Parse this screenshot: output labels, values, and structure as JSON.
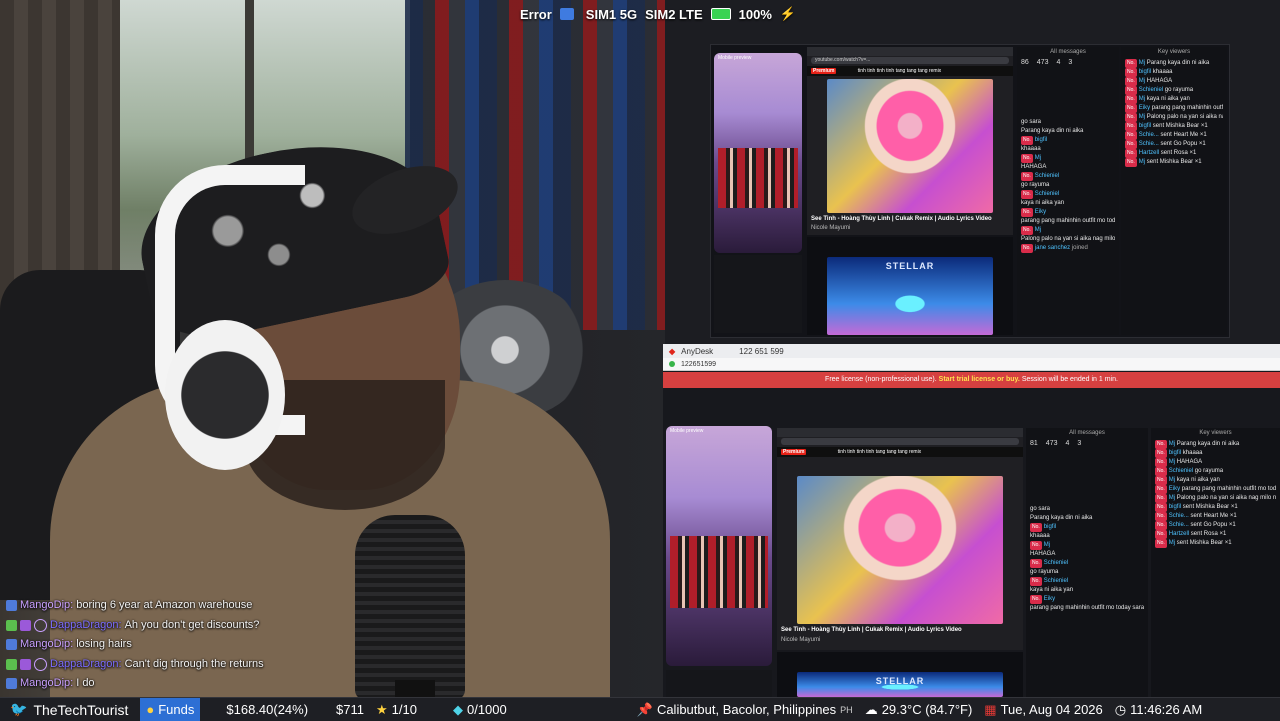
{
  "status_bar": {
    "error": "Error",
    "sim1": "SIM1 5G",
    "sim2": "SIM2 LTE",
    "battery": "100%"
  },
  "capture_top": {
    "phone_title": "Mobile preview",
    "url": "youtube.com/watch?v=...",
    "search_text": "tinh tinh tinh tinh tang tang tang remix",
    "video_title": "See Tinh - Hoàng Thùy Linh | Cukak Remix | Audio Lyrics Video",
    "channel": "Nicole Mayumi",
    "video2_text": "STELLAR",
    "stats": {
      "likes": "86",
      "viewers": "473",
      "hearts": "4",
      "people": "3"
    },
    "chat_header": "All messages",
    "side_header": "Key viewers",
    "chat": [
      {
        "user": "",
        "text": "go sara"
      },
      {
        "user": "",
        "text": "Parang kaya din ni aika"
      },
      {
        "user": "bigfil",
        "text": ""
      },
      {
        "user": "",
        "text": "khaaaa"
      },
      {
        "user": "Mj",
        "text": ""
      },
      {
        "user": "",
        "text": "HAHAGA"
      },
      {
        "user": "Schieniel",
        "text": ""
      },
      {
        "user": "",
        "text": "go rayuma"
      },
      {
        "user": "Schieniel",
        "text": ""
      },
      {
        "user": "",
        "text": "kaya ni aika yan"
      },
      {
        "user": "Eiky",
        "text": ""
      },
      {
        "user": "",
        "text": "parang pang mahinhin outfit mo today sarah"
      },
      {
        "user": "Mj",
        "text": ""
      },
      {
        "user": "",
        "text": "Palong palo na yan si aika nag milo na"
      },
      {
        "user": "jane sanchez",
        "text": "joined"
      }
    ],
    "side": [
      {
        "user": "Mj",
        "text": "Parang kaya din ni aika"
      },
      {
        "user": "bigfil",
        "text": "khaaaa"
      },
      {
        "user": "Mj",
        "text": "HAHAGA"
      },
      {
        "user": "Schieniel",
        "text": "go rayuma"
      },
      {
        "user": "Mj",
        "text": "kaya ni aika yan"
      },
      {
        "user": "Eiky",
        "text": "parang pang mahinhin outfit mo today sarah"
      },
      {
        "user": "Mj",
        "text": "Palong palo na yan si aika nag milo na"
      },
      {
        "user": "bigfil",
        "text": "sent Mishka Bear  ×1"
      },
      {
        "user": "Schie...",
        "text": "sent Heart Me  ×1"
      },
      {
        "user": "Schie...",
        "text": "sent Go Popu  ×1"
      },
      {
        "user": "Hartzell",
        "text": "sent Rosa  ×1"
      },
      {
        "user": "Mj",
        "text": "sent Mishka Bear  ×1"
      }
    ]
  },
  "anydesk": {
    "title": "AnyDesk",
    "id": "122 651 599",
    "id2": "122651599",
    "banner_prefix": "Free license (non-professional use).",
    "banner_link": "Start trial license or buy.",
    "banner_suffix": "Session will be ended in 1 min."
  },
  "capture_bottom": {
    "phone_title": "Mobile preview",
    "search_text": "tinh tinh tinh tinh tang tang tang remix",
    "video_title": "See Tinh - Hoàng Thùy Linh | Cukak Remix | Audio Lyrics Video",
    "channel": "Nicole Mayumi",
    "video2_text": "STELLAR",
    "stats": {
      "likes": "81",
      "viewers": "473",
      "hearts": "4",
      "people": "3"
    },
    "chat_header": "All messages",
    "side_header": "Key viewers",
    "chat": [
      {
        "user": "",
        "text": "go sara"
      },
      {
        "user": "",
        "text": "Parang kaya din ni aika"
      },
      {
        "user": "bigfil",
        "text": ""
      },
      {
        "user": "",
        "text": "khaaaa"
      },
      {
        "user": "Mj",
        "text": ""
      },
      {
        "user": "",
        "text": "HAHAGA"
      },
      {
        "user": "Schieniel",
        "text": ""
      },
      {
        "user": "",
        "text": "go rayuma"
      },
      {
        "user": "Schieniel",
        "text": ""
      },
      {
        "user": "",
        "text": "kaya ni aika yan"
      },
      {
        "user": "Eiky",
        "text": ""
      },
      {
        "user": "",
        "text": "parang pang mahinhin outfit mo today sarah"
      }
    ],
    "side": [
      {
        "user": "Mj",
        "text": "Parang kaya din ni aika"
      },
      {
        "user": "bigfil",
        "text": "khaaaa"
      },
      {
        "user": "Mj",
        "text": "HAHAGA"
      },
      {
        "user": "Schieniel",
        "text": "go rayuma"
      },
      {
        "user": "Mj",
        "text": "kaya ni aika yan"
      },
      {
        "user": "Eiky",
        "text": "parang pang mahinhin outfit mo today sarah"
      },
      {
        "user": "Mj",
        "text": "Palong palo na yan si aika nag milo na"
      },
      {
        "user": "bigfil",
        "text": "sent Mishka Bear  ×1"
      },
      {
        "user": "Schie...",
        "text": "sent Heart Me  ×1"
      },
      {
        "user": "Schie...",
        "text": "sent Go Popu  ×1"
      },
      {
        "user": "Hartzell",
        "text": "sent Rosa  ×1"
      },
      {
        "user": "Mj",
        "text": "sent Mishka Bear  ×1"
      }
    ]
  },
  "overlay_chat": [
    {
      "user": "MangoDip",
      "msg": "boring 6 year at Amazon warehouse",
      "color": "#c8a0ff"
    },
    {
      "user": "DappaDragon",
      "msg": "Ah you don't get discounts?",
      "color": "#7b6cff"
    },
    {
      "user": "MangoDip",
      "msg": "losing hairs",
      "color": "#c8a0ff"
    },
    {
      "user": "DappaDragon",
      "msg": "Can't dig through the returns",
      "color": "#7b6cff"
    },
    {
      "user": "MangoDip",
      "msg": "I do",
      "color": "#c8a0ff"
    }
  ],
  "ticker": {
    "handle": "TheTechTourist",
    "funds_label": "Funds",
    "funds_value": "$168.40(24%)",
    "amount": "$711",
    "stars": "1/10",
    "gems": "0/1000",
    "location": "Calibutbut, Bacolor, Philippines",
    "country": "PH",
    "weather": "29.3°C (84.7°F)",
    "date": "Tue, Aug 04 2026",
    "time": "11:46:26 AM"
  },
  "colors": {
    "funds_bg": "#2d6fd4",
    "anydesk_banner": "#d64040",
    "twitter": "#1da1f2"
  }
}
